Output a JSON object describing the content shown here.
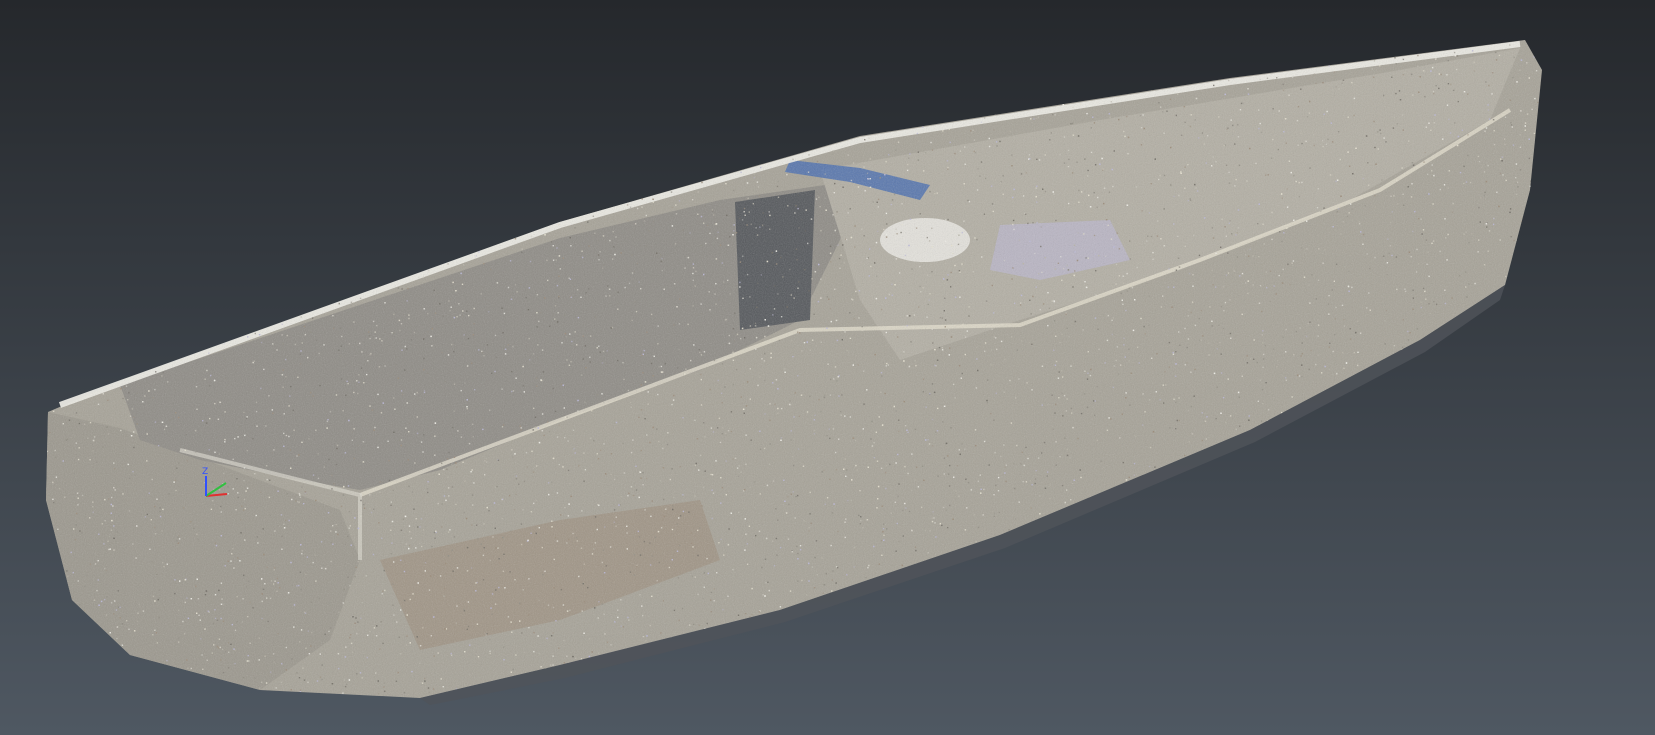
{
  "viewport": {
    "background_top": "#25282c",
    "background_bottom": "#4f5862",
    "model": {
      "type": "point-cloud",
      "subject": "boat",
      "point_colors": [
        "#f2f1ea",
        "#d9d6cc",
        "#b8b4a8",
        "#8e8a80",
        "#6e6a62",
        "#bcb9d8",
        "#9a8a78",
        "#e8e3d2"
      ],
      "hull_tint": "#a7a398",
      "interior_tint": "#8f8c86",
      "waterline_tint": "#50545a",
      "accent_blue": "#4a6fb0"
    },
    "axis_gizmo": {
      "x_color": "#e03030",
      "y_color": "#30c040",
      "z_color": "#3050ff",
      "z_label": "Z"
    }
  }
}
